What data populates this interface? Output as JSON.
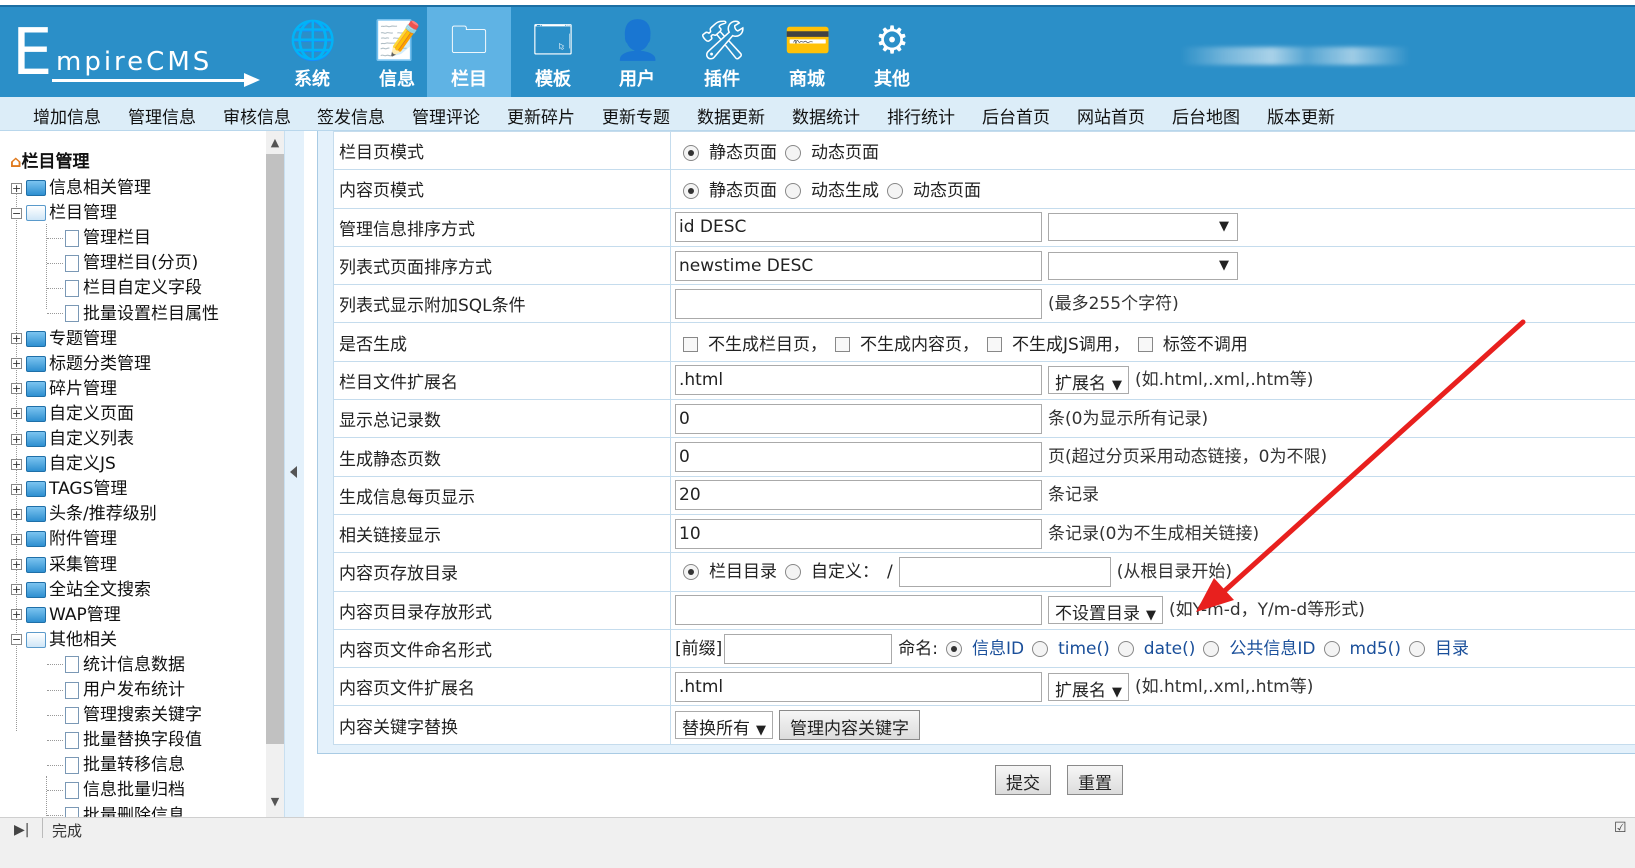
{
  "logo": {
    "big": "E",
    "rest": "mpireCMS"
  },
  "topnav": [
    {
      "label": "系统",
      "icon": "globe-icon",
      "glyph": "🌐"
    },
    {
      "label": "信息",
      "icon": "document-pencil-icon",
      "glyph": "📝"
    },
    {
      "label": "栏目",
      "icon": "folder-icon",
      "glyph": "🗀",
      "active": true
    },
    {
      "label": "模板",
      "icon": "window-icon",
      "glyph": "🗔"
    },
    {
      "label": "用户",
      "icon": "user-icon",
      "glyph": "👤"
    },
    {
      "label": "插件",
      "icon": "tools-icon",
      "glyph": "🛠"
    },
    {
      "label": "商城",
      "icon": "card-icon",
      "glyph": "💳"
    },
    {
      "label": "其他",
      "icon": "gear-icon",
      "glyph": "⚙"
    }
  ],
  "subnav": [
    "增加信息",
    "管理信息",
    "审核信息",
    "签发信息",
    "管理评论",
    "更新碎片",
    "更新专题",
    "数据更新",
    "数据统计",
    "排行统计",
    "后台首页",
    "网站首页",
    "后台地图",
    "版本更新"
  ],
  "sidebar": {
    "title": "栏目管理",
    "items": [
      {
        "label": "信息相关管理",
        "level": 0,
        "type": "folder",
        "expander": "+"
      },
      {
        "label": "栏目管理",
        "level": 0,
        "type": "folder-open",
        "expander": "-"
      },
      {
        "label": "管理栏目",
        "level": 1,
        "type": "doc"
      },
      {
        "label": "管理栏目(分页)",
        "level": 1,
        "type": "doc"
      },
      {
        "label": "栏目自定义字段",
        "level": 1,
        "type": "doc"
      },
      {
        "label": "批量设置栏目属性",
        "level": 1,
        "type": "doc"
      },
      {
        "label": "专题管理",
        "level": 0,
        "type": "folder",
        "expander": "+"
      },
      {
        "label": "标题分类管理",
        "level": 0,
        "type": "folder",
        "expander": "+"
      },
      {
        "label": "碎片管理",
        "level": 0,
        "type": "folder",
        "expander": "+"
      },
      {
        "label": "自定义页面",
        "level": 0,
        "type": "folder",
        "expander": "+"
      },
      {
        "label": "自定义列表",
        "level": 0,
        "type": "folder",
        "expander": "+"
      },
      {
        "label": "自定义JS",
        "level": 0,
        "type": "folder",
        "expander": "+"
      },
      {
        "label": "TAGS管理",
        "level": 0,
        "type": "folder",
        "expander": "+"
      },
      {
        "label": "头条/推荐级别",
        "level": 0,
        "type": "folder",
        "expander": "+"
      },
      {
        "label": "附件管理",
        "level": 0,
        "type": "folder",
        "expander": "+"
      },
      {
        "label": "采集管理",
        "level": 0,
        "type": "folder",
        "expander": "+"
      },
      {
        "label": "全站全文搜索",
        "level": 0,
        "type": "folder",
        "expander": "+"
      },
      {
        "label": "WAP管理",
        "level": 0,
        "type": "folder",
        "expander": "+"
      },
      {
        "label": "其他相关",
        "level": 0,
        "type": "folder-open",
        "expander": "-"
      },
      {
        "label": "统计信息数据",
        "level": 1,
        "type": "doc"
      },
      {
        "label": "用户发布统计",
        "level": 1,
        "type": "doc"
      },
      {
        "label": "管理搜索关键字",
        "level": 1,
        "type": "doc"
      },
      {
        "label": "批量替换字段值",
        "level": 1,
        "type": "doc"
      },
      {
        "label": "批量转移信息",
        "level": 1,
        "type": "doc"
      },
      {
        "label": "信息批量归档",
        "level": 1,
        "type": "doc"
      },
      {
        "label": "批量删除信息",
        "level": 1,
        "type": "doc"
      }
    ]
  },
  "form": {
    "rows": [
      {
        "label": "栏目页模式",
        "radios": [
          {
            "text": "静态页面",
            "on": true
          },
          {
            "text": "动态页面",
            "on": false
          }
        ]
      },
      {
        "label": "内容页模式",
        "radios": [
          {
            "text": "静态页面",
            "on": true
          },
          {
            "text": "动态生成",
            "on": false
          },
          {
            "text": "动态页面",
            "on": false
          }
        ]
      },
      {
        "label": "管理信息排序方式",
        "input": "id DESC",
        "select": ""
      },
      {
        "label": "列表式页面排序方式",
        "input": "newstime DESC",
        "select": ""
      },
      {
        "label": "列表式显示附加SQL条件",
        "input": "",
        "hint": "(最多255个字符)"
      },
      {
        "label": "是否生成",
        "checks": [
          "不生成栏目页，",
          "不生成内容页，",
          "不生成JS调用，",
          "标签不调用"
        ]
      },
      {
        "label": "栏目文件扩展名",
        "input": ".html",
        "select": "扩展名",
        "hint": "(如.html,.xml,.htm等)"
      },
      {
        "label": "显示总记录数",
        "input": "0",
        "hint": "条(0为显示所有记录)"
      },
      {
        "label": "生成静态页数",
        "input": "0",
        "hint": "页(超过分页采用动态链接，0为不限)"
      },
      {
        "label": "生成信息每页显示",
        "input": "20",
        "hint": "条记录"
      },
      {
        "label": "相关链接显示",
        "input": "10",
        "hint": "条记录(0为不生成相关链接)"
      },
      {
        "label": "内容页存放目录",
        "radios": [
          {
            "text": "栏目目录",
            "on": true
          },
          {
            "text": "自定义：",
            "on": false
          }
        ],
        "slash": "/",
        "input": "",
        "hint": "(从根目录开始)"
      },
      {
        "label": "内容页目录存放形式",
        "input": "",
        "select": "不设置目录",
        "hint": "(如Y-m-d，Y/m-d等形式)"
      },
      {
        "label": "内容页文件命名形式",
        "prefix": "[前缀]",
        "prefix_input": "",
        "name_label": "命名:",
        "radios": [
          {
            "text": "信息ID",
            "on": true
          },
          {
            "text": "time()",
            "on": false
          },
          {
            "text": "date()",
            "on": false
          },
          {
            "text": "公共信息ID",
            "on": false
          },
          {
            "text": "md5()",
            "on": false
          },
          {
            "text": "目录",
            "on": false
          }
        ]
      },
      {
        "label": "内容页文件扩展名",
        "input": ".html",
        "select": "扩展名",
        "hint": "(如.html,.xml,.htm等)"
      },
      {
        "label": "内容关键字替换",
        "select": "替换所有",
        "button": "管理内容关键字"
      }
    ],
    "submit": "提交",
    "reset": "重置"
  },
  "statusbar": {
    "text": "完成"
  },
  "colors": {
    "header": "#2b8fc8",
    "subnav": "#dcedf8",
    "arrow": "#e8201e",
    "link": "#1a4f9a"
  }
}
